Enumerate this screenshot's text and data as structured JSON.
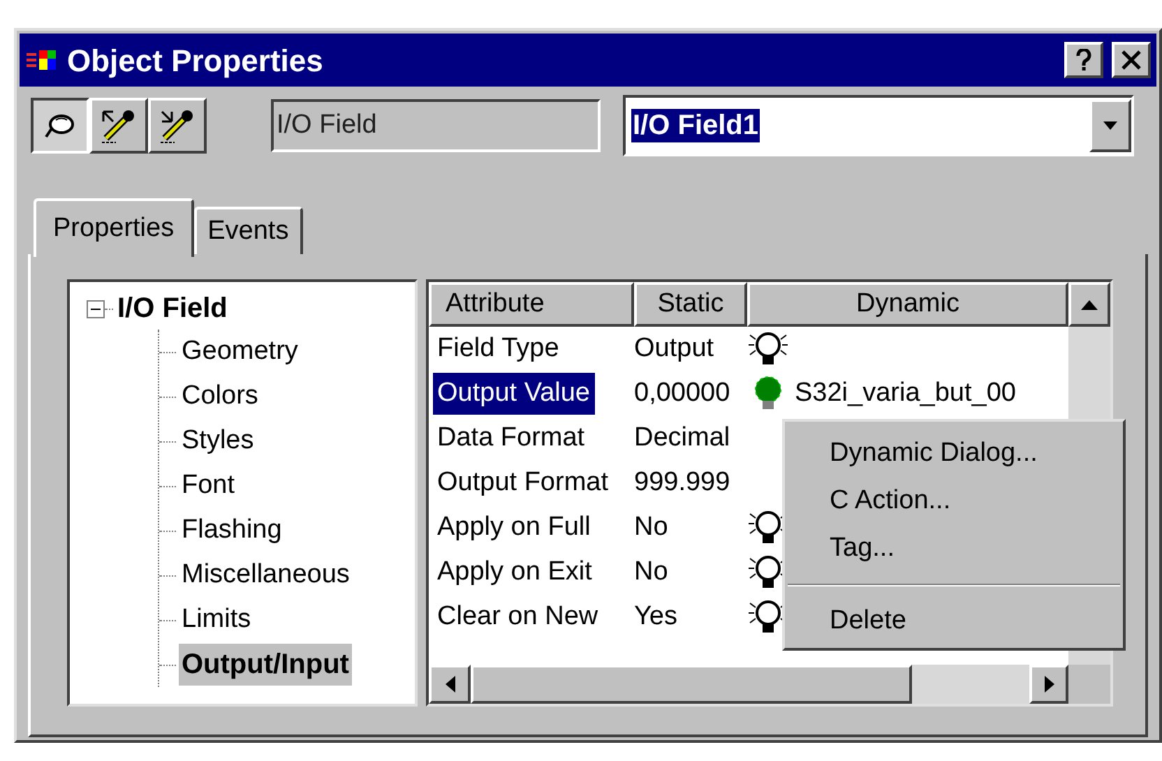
{
  "window": {
    "title": "Object Properties"
  },
  "toolbar": {
    "object_type": "I/O Field",
    "object_name": "I/O Field1"
  },
  "tabs": [
    {
      "label": "Properties",
      "selected": true
    },
    {
      "label": "Events",
      "selected": false
    }
  ],
  "tree": {
    "label": "I/O Field",
    "expanded": true,
    "children": [
      {
        "label": "Geometry",
        "selected": false
      },
      {
        "label": "Colors",
        "selected": false
      },
      {
        "label": "Styles",
        "selected": false
      },
      {
        "label": "Font",
        "selected": false
      },
      {
        "label": "Flashing",
        "selected": false
      },
      {
        "label": "Miscellaneous",
        "selected": false
      },
      {
        "label": "Limits",
        "selected": false
      },
      {
        "label": "Output/Input",
        "selected": true
      }
    ]
  },
  "table": {
    "columns": [
      "Attribute",
      "Static",
      "Dynamic"
    ],
    "rows": [
      {
        "attribute": "Field Type",
        "static": "Output",
        "has_bulb": true,
        "lit": false,
        "selected": false
      },
      {
        "attribute": "Output Value",
        "static": "0,00000",
        "has_bulb": true,
        "lit": true,
        "dynamic_text": "S32i_varia_but_00",
        "selected": true
      },
      {
        "attribute": "Data Format",
        "static": "Decimal",
        "has_bulb": false,
        "selected": false
      },
      {
        "attribute": "Output Format",
        "static": "999.999",
        "has_bulb": false,
        "selected": false
      },
      {
        "attribute": "Apply on Full",
        "static": "No",
        "has_bulb": true,
        "lit": false,
        "selected": false
      },
      {
        "attribute": "Apply on Exit",
        "static": "No",
        "has_bulb": true,
        "lit": false,
        "selected": false
      },
      {
        "attribute": "Clear on New",
        "static": "Yes",
        "has_bulb": true,
        "lit": false,
        "selected": false
      }
    ]
  },
  "context_menu": {
    "items": [
      {
        "kind": "item",
        "label": "Dynamic Dialog..."
      },
      {
        "kind": "item",
        "label": "C Action..."
      },
      {
        "kind": "item",
        "label": "Tag..."
      },
      {
        "kind": "separator"
      },
      {
        "kind": "item",
        "label": "Delete"
      }
    ]
  }
}
